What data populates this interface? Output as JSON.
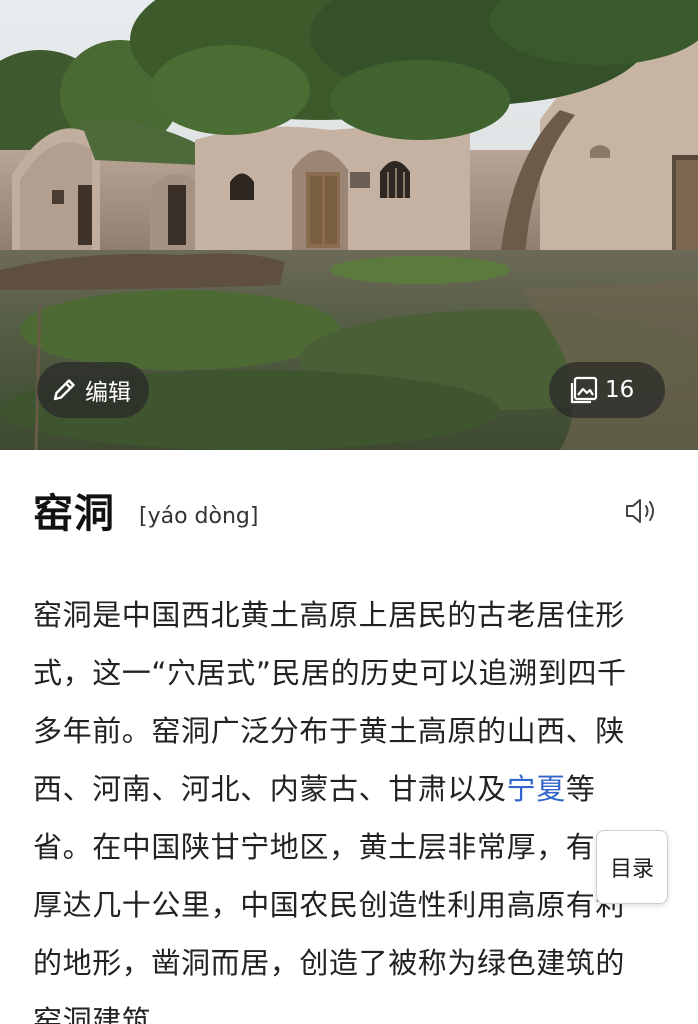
{
  "hero": {
    "edit_label": "编辑",
    "image_count": "16"
  },
  "entry": {
    "title": "窑洞",
    "pinyin": "[yáo dòng]",
    "paragraph": {
      "before_link": "窑洞是中国西北黄土高原上居民的古老居住形式，这一“穴居式”民居的历史可以追溯到四千多年前。窑洞广泛分布于黄土高原的山西、陕西、河南、河北、内蒙古、甘肃以及",
      "link_text": "宁夏",
      "after_link": "等省。在中国陕甘宁地区，黄土层非常厚，有的厚达几十公里，中国农民创造性利用高原有利的地形，凿洞而居，创造了被称为绿色建筑的窑洞建筑。"
    }
  },
  "toc": {
    "label": "目录"
  },
  "icons": {
    "edit": "pencil-icon",
    "gallery": "image-gallery-icon",
    "audio": "speaker-icon"
  },
  "colors": {
    "link": "#3366cc",
    "pill_bg": "#282828",
    "text": "#222222"
  }
}
